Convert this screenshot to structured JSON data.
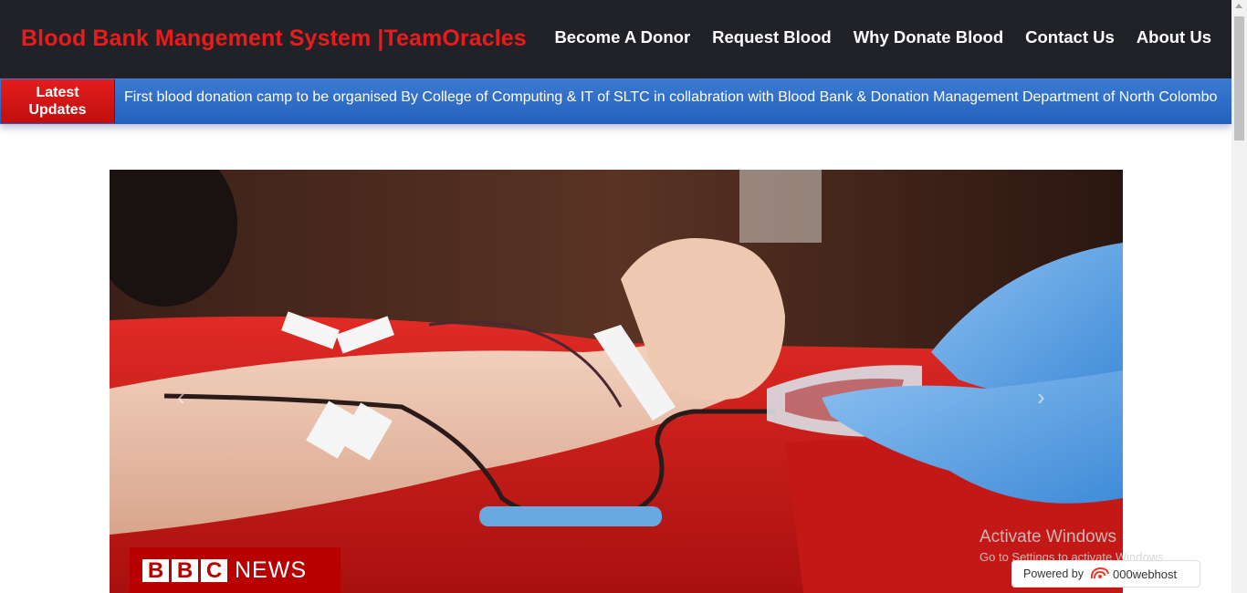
{
  "navbar": {
    "brand": "Blood Bank Mangement System |TeamOracles",
    "links": [
      "Become A Donor",
      "Request Blood",
      "Why Donate Blood",
      "Contact Us",
      "About Us"
    ]
  },
  "updates": {
    "label_line1": "Latest",
    "label_line2": "Updates",
    "ticker_text": "First blood donation camp to be organised By College of Computing & IT of SLTC in collabration with Blood Bank & Donation Management Department of North Colombo"
  },
  "carousel": {
    "image_watermark_letters": [
      "B",
      "B",
      "C"
    ],
    "image_watermark_word": "NEWS",
    "prev_arrow": "‹",
    "next_arrow": "›"
  },
  "overlay": {
    "activate_title": "Activate Windows",
    "activate_sub": "Go to Settings to activate Windows.",
    "powered_by": "Powered by",
    "host": "000webhost",
    "host_icon": "webhost-swirl-icon"
  },
  "colors": {
    "navbar_bg": "#202227",
    "brand": "#ec1b1b",
    "updates_bar": "#2d6bc7",
    "latest_label": "#d41515"
  }
}
